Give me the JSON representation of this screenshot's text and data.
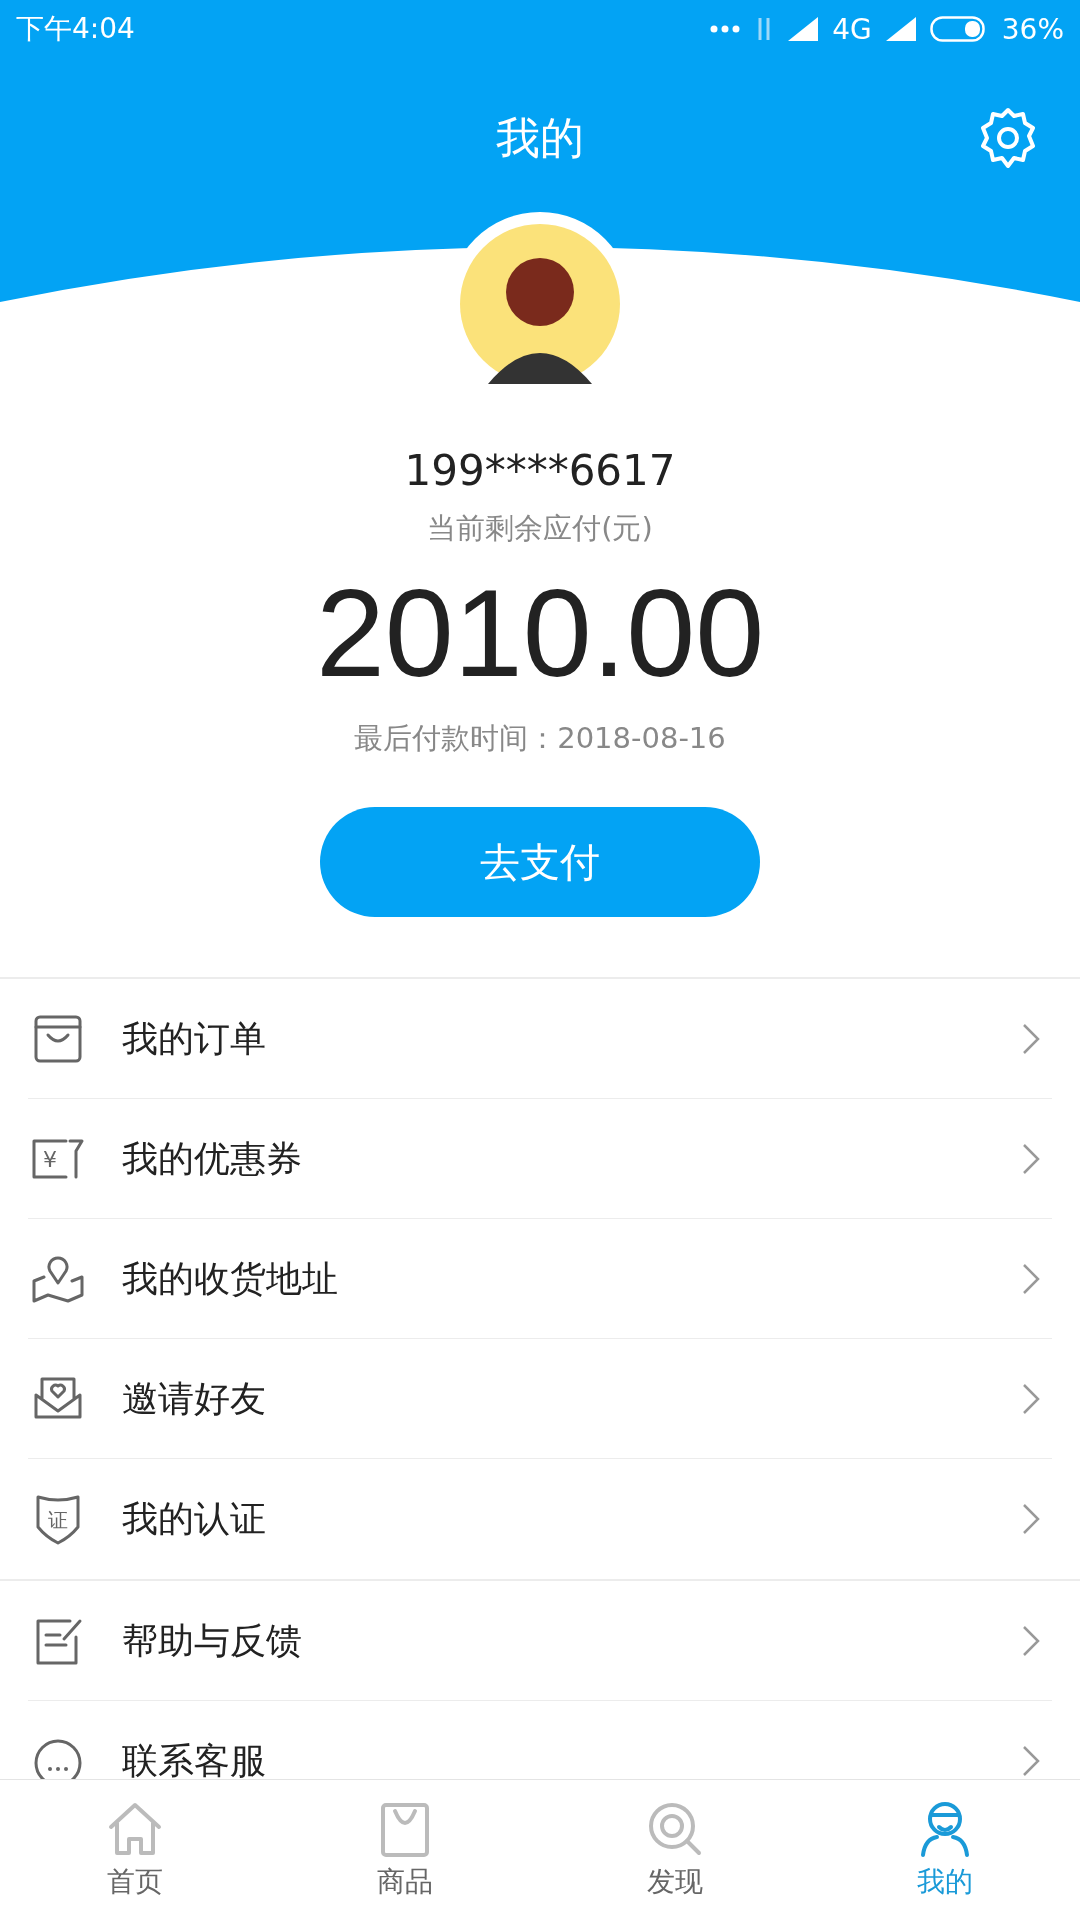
{
  "status_bar": {
    "time": "下午4:04",
    "network": "4G",
    "battery": "36%"
  },
  "header": {
    "title": "我的"
  },
  "profile": {
    "phone": "199****6617",
    "balance_label": "当前剩余应付(元)",
    "balance": "2010.00",
    "due": "最后付款时间：2018-08-16",
    "pay_button": "去支付"
  },
  "menu_groups": [
    {
      "items": [
        {
          "kind": "orders",
          "label": "我的订单"
        },
        {
          "kind": "coupons",
          "label": "我的优惠券",
          "icon_text": "¥"
        },
        {
          "kind": "address",
          "label": "我的收货地址"
        },
        {
          "kind": "invite",
          "label": "邀请好友"
        },
        {
          "kind": "verify",
          "label": "我的认证",
          "icon_text": "证"
        }
      ]
    },
    {
      "items": [
        {
          "kind": "help",
          "label": "帮助与反馈"
        },
        {
          "kind": "service",
          "label": "联系客服"
        }
      ]
    }
  ],
  "tab_bar": [
    {
      "kind": "home",
      "label": "首页",
      "selected": false
    },
    {
      "kind": "goods",
      "label": "商品",
      "selected": false
    },
    {
      "kind": "discover",
      "label": "发现",
      "selected": false
    },
    {
      "kind": "me",
      "label": "我的",
      "selected": true
    }
  ]
}
